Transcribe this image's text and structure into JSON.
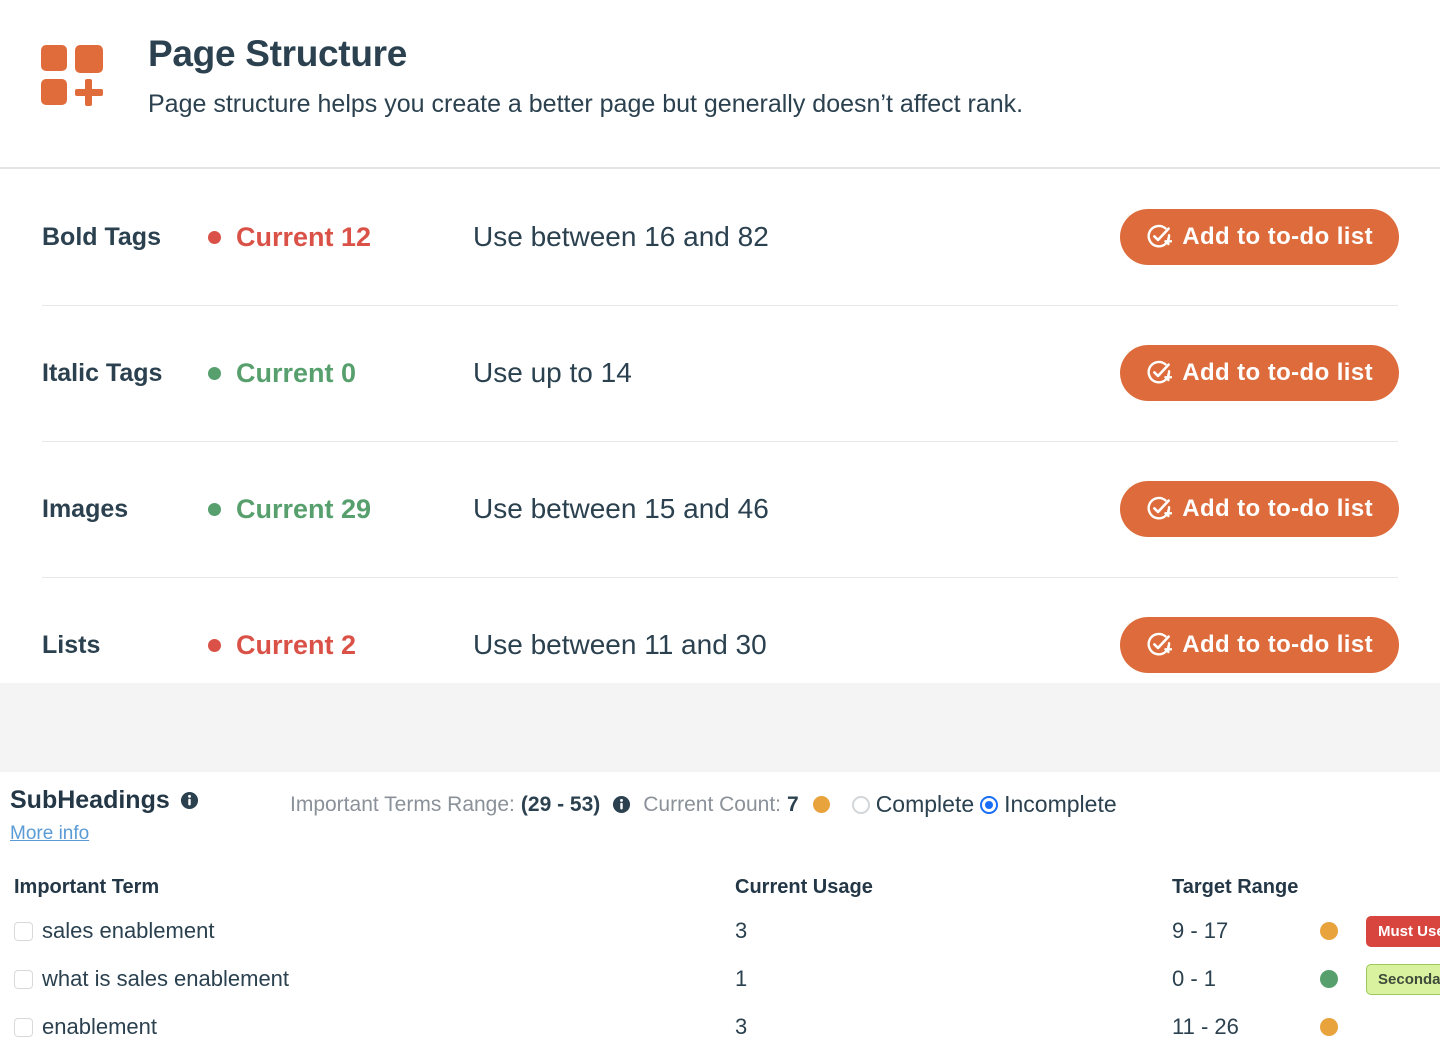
{
  "header": {
    "icon": "page-structure-icon",
    "title": "Page Structure",
    "subtitle": "Page structure helps you create a better page but generally doesn’t affect rank."
  },
  "colors": {
    "accent": "#dd6b3b",
    "icon_orange": "#e06c3c",
    "bad": "#da5247",
    "good": "#57a06e",
    "warn": "#e8a33d",
    "radio_selected": "#1a6ef5",
    "link": "#5b9bd5",
    "text_dark": "#2b414f",
    "badge_must_use": "#d8453f",
    "badge_secondary": "#d9f29f",
    "gray_band": "#f4f4f5"
  },
  "metrics": {
    "action_label": "Add to to-do list",
    "action_icon": "circle-check-plus-icon",
    "rows": [
      {
        "label": "Bold Tags",
        "current": "Current 12",
        "status": "bad",
        "advice": "Use between 16 and 82"
      },
      {
        "label": "Italic Tags",
        "current": "Current 0",
        "status": "good",
        "advice": "Use up to 14"
      },
      {
        "label": "Images",
        "current": "Current 29",
        "status": "good",
        "advice": "Use between 15 and 46"
      },
      {
        "label": "Lists",
        "current": "Current 2",
        "status": "bad",
        "advice": "Use between 11 and 30"
      }
    ]
  },
  "subheadings": {
    "title": "SubHeadings",
    "title_info_icon": "info-icon",
    "more_info_label": "More info",
    "range_label": "Important Terms Range:",
    "range_value": "(29 - 53)",
    "range_info_icon": "info-icon",
    "count_label": "Current Count:",
    "count_value": "7",
    "count_dot": "warn",
    "filters": [
      {
        "label": "Complete",
        "selected": false
      },
      {
        "label": "Incomplete",
        "selected": true
      }
    ],
    "table": {
      "columns": [
        "Important Term",
        "Current Usage",
        "Target Range"
      ],
      "rows": [
        {
          "term": "sales enablement",
          "checked": false,
          "usage": "3",
          "range": "9 - 17",
          "dot": "warn",
          "badge": "Must Use",
          "badge_type": "must"
        },
        {
          "term": "what is sales enablement",
          "checked": false,
          "usage": "1",
          "range": "0 - 1",
          "dot": "good",
          "badge": "Secondary KW",
          "badge_type": "secondary"
        },
        {
          "term": "enablement",
          "checked": false,
          "usage": "3",
          "range": "11 - 26",
          "dot": "warn",
          "badge": "",
          "badge_type": "none"
        }
      ]
    }
  }
}
